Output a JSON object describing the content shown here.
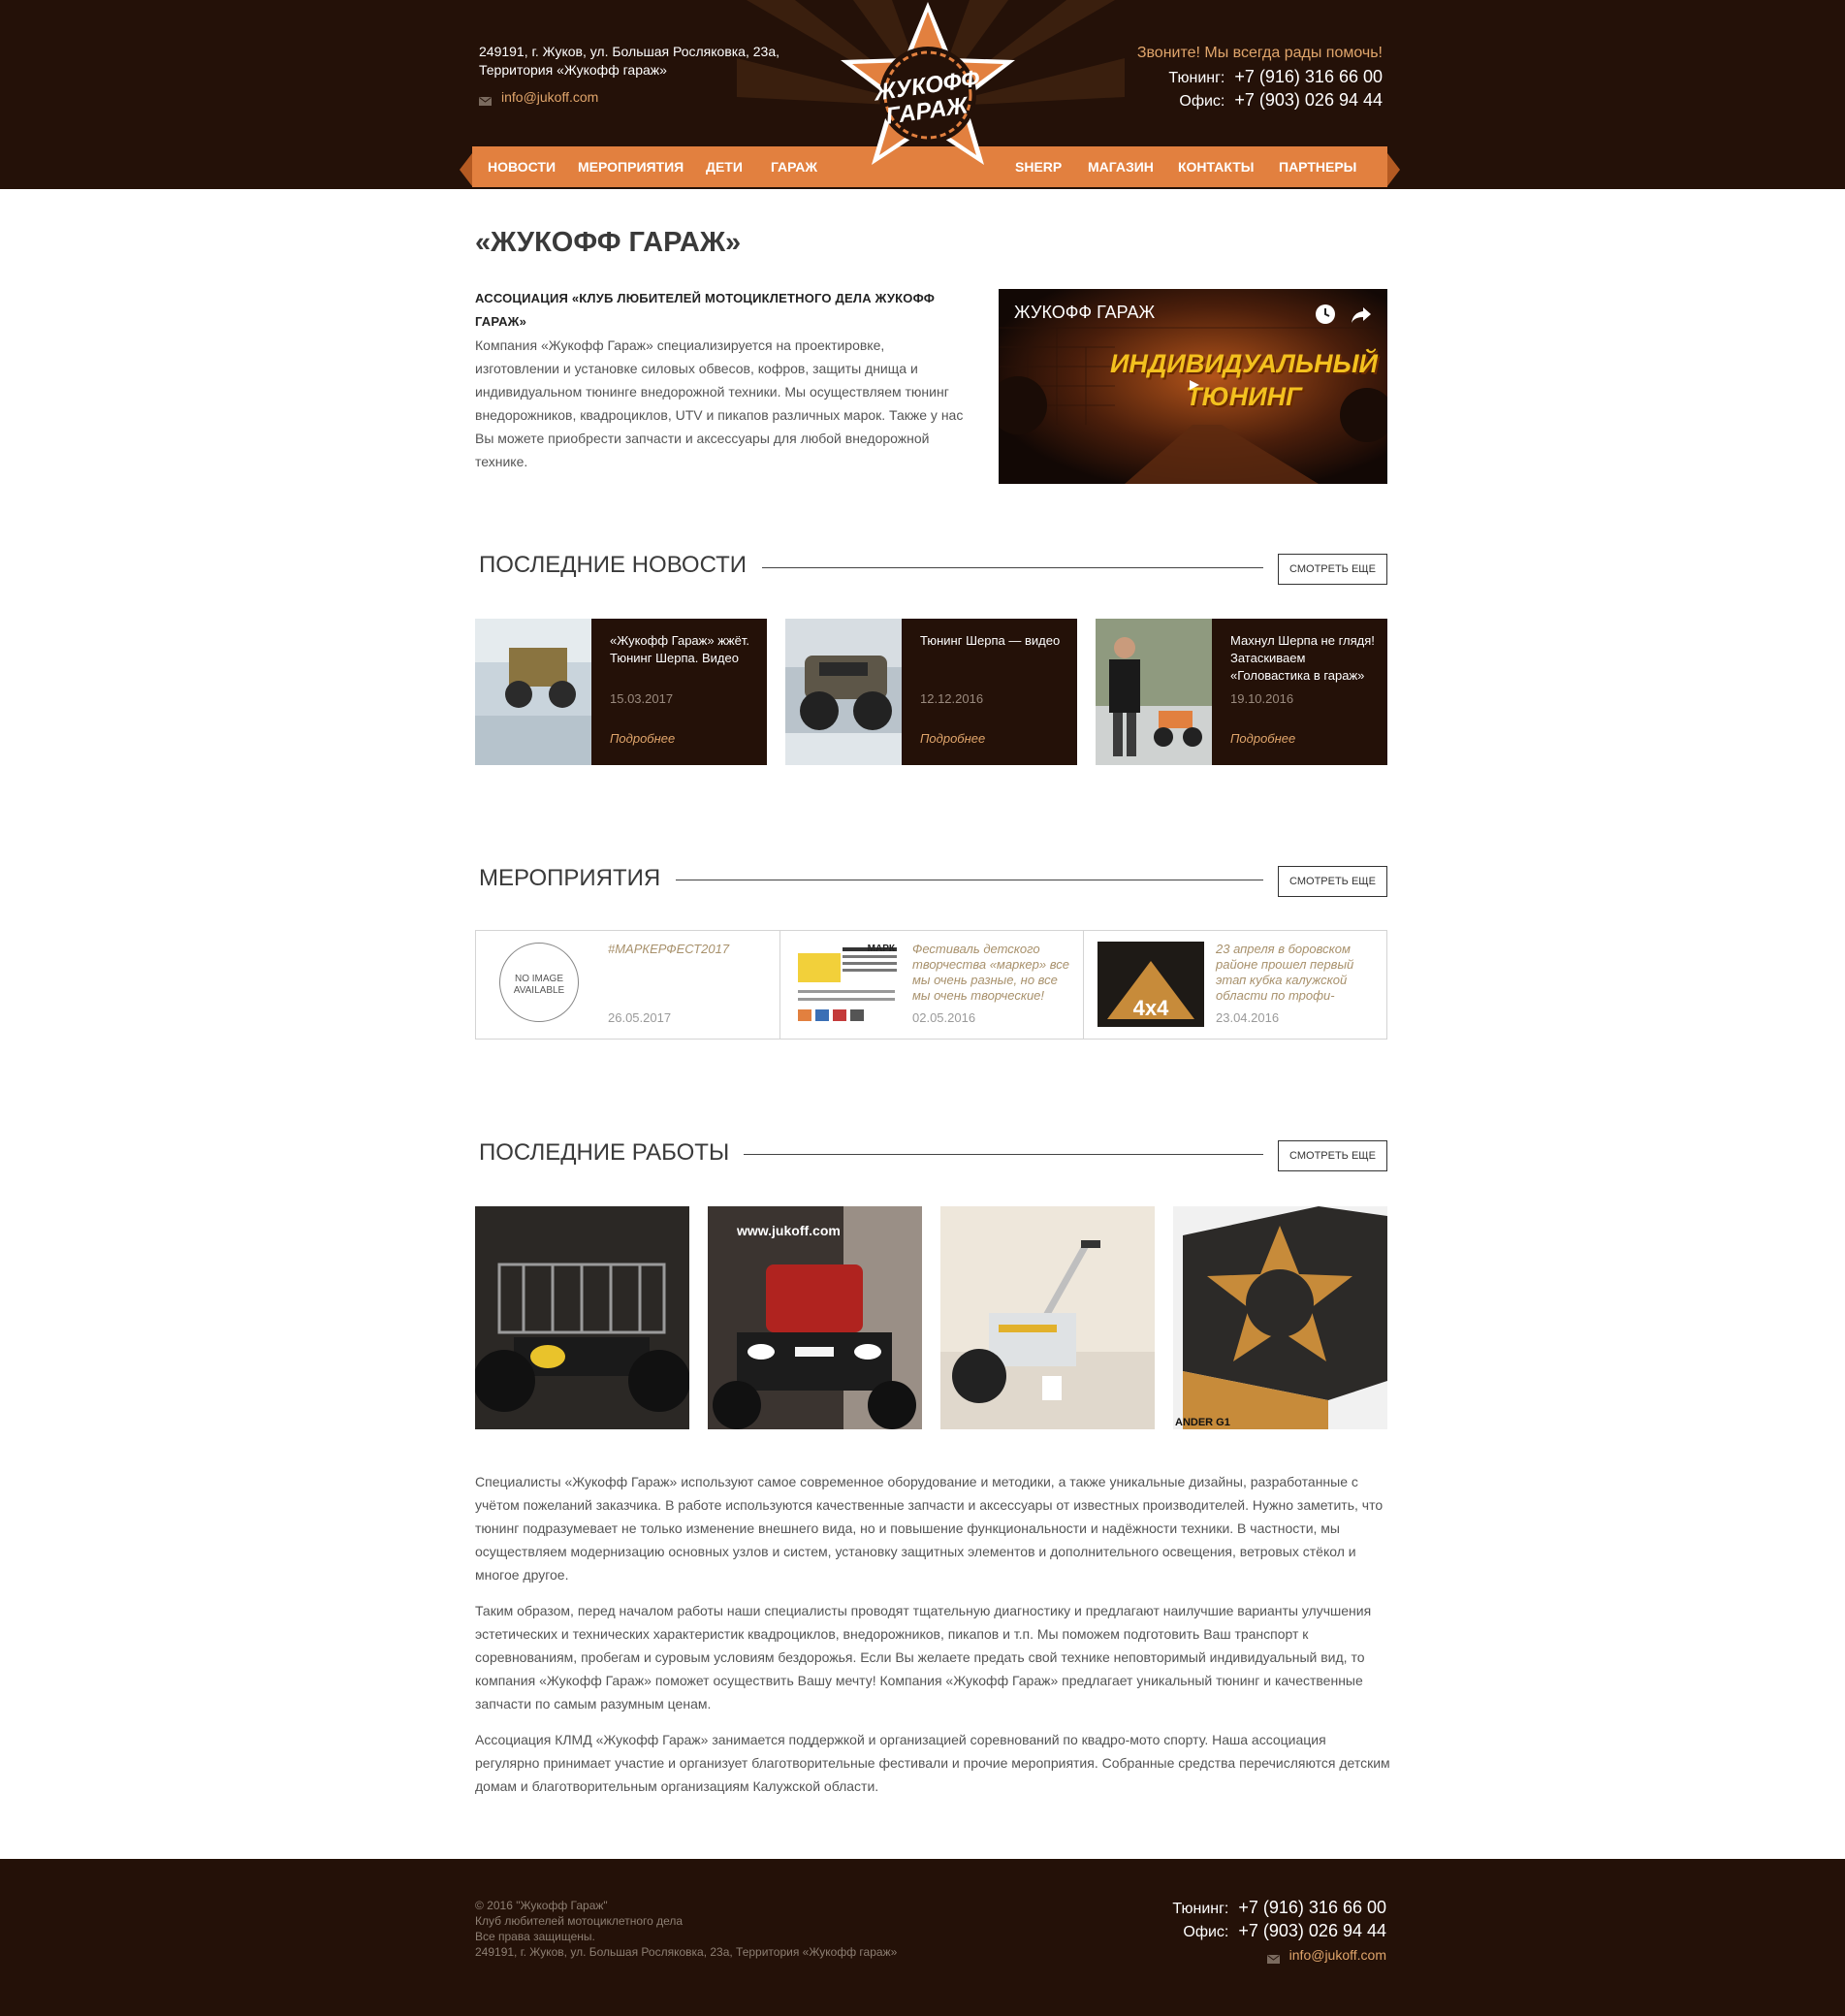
{
  "header": {
    "address": "249191, г. Жуков, ул. Большая Росляковка, 23а, Территория «Жукофф гараж»",
    "email": "info@jukoff.com",
    "call_text": "Звоните! Мы всегда рады помочь!",
    "phones": [
      {
        "label": "Тюнинг:",
        "number": "+7 (916) 316 66 00"
      },
      {
        "label": "Офис:",
        "number": "+7 (903) 026 94 44"
      }
    ],
    "logo_lines": [
      "ЖУКОФФ",
      "ГАРАЖ"
    ]
  },
  "nav": {
    "left": [
      "НОВОСТИ",
      "МЕРОПРИЯТИЯ",
      "ДЕТИ",
      "ГАРАЖ"
    ],
    "right": [
      "SHERP",
      "МАГАЗИН",
      "КОНТАКТЫ",
      "ПАРТНЕРЫ"
    ]
  },
  "page_title": "«ЖУКОФФ ГАРАЖ»",
  "intro": {
    "heading": "АССОЦИАЦИЯ «КЛУБ ЛЮБИТЕЛЕЙ МОТОЦИКЛЕТНОГО ДЕЛА ЖУКОФФ ГАРАЖ»",
    "body": "Компания «Жукофф Гараж» специализируется на проектировке, изготовлении и установке силовых обвесов, кофров, защиты днища и индивидуальном тюнинге внедорожной техники. Мы осуществляем тюнинг внедорожников, квадроциклов, UTV и пикапов различных марок. Также у нас Вы можете приобрести запчасти и аксессуары для любой внедорожной технике."
  },
  "video": {
    "title": "ЖУКОФФ ГАРАЖ",
    "banner_line1": "ИНДИВИДУАЛЬНЫЙ",
    "banner_line2": "ТЮНИНГ"
  },
  "more_label": "СМОТРЕТЬ ЕЩЕ",
  "news": {
    "heading": "ПОСЛЕДНИЕ НОВОСТИ",
    "more_link": "Подробнее",
    "items": [
      {
        "title": "«Жукофф Гараж» жжёт. Тюнинг Шерпа. Видео",
        "date": "15.03.2017"
      },
      {
        "title": "Тюнинг Шерпа — видео",
        "date": "12.12.2016"
      },
      {
        "title": "Махнул Шерпа не глядя! Затаскиваем «Головастика в гараж»",
        "date": "19.10.2016"
      }
    ]
  },
  "events": {
    "heading": "МЕРОПРИЯТИЯ",
    "no_image": "NO IMAGE AVAILABLE",
    "items": [
      {
        "text": "#МАРКЕРФЕСТ2017",
        "date": "26.05.2017"
      },
      {
        "text": "Фестиваль детского творчества «маркер» все мы очень разные, но все мы очень творческие!",
        "date": "02.05.2016",
        "poster_label": "МАРК"
      },
      {
        "text": "23 апреля в боровском районе прошел первый этап кубка калужской области по трофи-",
        "date": "23.04.2016",
        "poster_label": "4x4"
      }
    ]
  },
  "works": {
    "heading": "ПОСЛЕДНИЕ РАБОТЫ",
    "caption_site": "www.jukoff.com",
    "caption_model": "ANDER G1"
  },
  "about_paragraphs": [
    "Специалисты «Жукофф Гараж» используют самое современное оборудование и методики, а также уникальные дизайны, разработанные с учётом пожеланий заказчика. В работе используются качественные запчасти и аксессуары от известных производителей. Нужно заметить, что тюнинг подразумевает не только изменение внешнего вида, но и повышение функциональности и надёжности техники. В частности, мы осуществляем модернизацию основных узлов и систем, установку защитных элементов и дополнительного освещения, ветровых стёкол и многое другое.",
    "Таким образом, перед началом работы наши специалисты проводят тщательную диагностику и предлагают наилучшие варианты улучшения эстетических и технических характеристик квадроциклов, внедорожников, пикапов и т.п. Мы поможем подготовить Ваш транспорт к соревнованиям, пробегам и суровым условиям бездорожья. Если Вы желаете предать свой технике неповторимый индивидуальный вид, то компания «Жукофф Гараж» поможет осуществить Вашу мечту! Компания «Жукофф Гараж» предлагает уникальный тюнинг и качественные запчасти по самым разумным ценам.",
    "Ассоциация КЛМД «Жукофф Гараж» занимается поддержкой и организацией соревнований по квадро-мото спорту. Наша ассоциация регулярно принимает участие и организует благотворительные фестивали и прочие мероприятия. Собранные средства перечисляются детским домам и благотворительным организациям Калужской области."
  ],
  "footer": {
    "lines": [
      "© 2016 \"Жукофф Гараж\"",
      "Клуб любителей мотоциклетного дела",
      "Все права защищены.",
      "249191, г. Жуков, ул. Большая Росляковка, 23а, Территория «Жукофф гараж»"
    ],
    "phones": [
      {
        "label": "Тюнинг:",
        "number": "+7 (916) 316 66 00"
      },
      {
        "label": "Офис:",
        "number": "+7 (903) 026 94 44"
      }
    ],
    "email": "info@jukoff.com"
  },
  "colors": {
    "dark_brown": "#241108",
    "orange": "#e2803f",
    "accent_text": "#e0a56b"
  }
}
